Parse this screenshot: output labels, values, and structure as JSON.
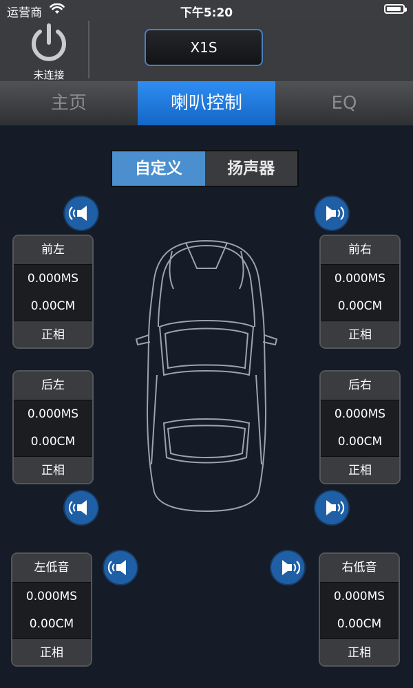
{
  "status_bar": {
    "carrier": "运营商",
    "time": "下午5:20",
    "battery_level": 0.9
  },
  "header": {
    "power_label": "未连接",
    "device_name": "X1S"
  },
  "tabs": [
    {
      "label": "主页",
      "active": false
    },
    {
      "label": "喇叭控制",
      "active": true
    },
    {
      "label": "EQ",
      "active": false
    }
  ],
  "segment": [
    {
      "label": "自定义",
      "active": true
    },
    {
      "label": "扬声器",
      "active": false
    }
  ],
  "channels": {
    "front_left": {
      "name": "前左",
      "delay": "0.000MS",
      "distance": "0.00CM",
      "phase": "正相"
    },
    "front_right": {
      "name": "前右",
      "delay": "0.000MS",
      "distance": "0.00CM",
      "phase": "正相"
    },
    "rear_left": {
      "name": "后左",
      "delay": "0.000MS",
      "distance": "0.00CM",
      "phase": "正相"
    },
    "rear_right": {
      "name": "后右",
      "delay": "0.000MS",
      "distance": "0.00CM",
      "phase": "正相"
    },
    "sub_left": {
      "name": "左低音",
      "delay": "0.000MS",
      "distance": "0.00CM",
      "phase": "正相"
    },
    "sub_right": {
      "name": "右低音",
      "delay": "0.000MS",
      "distance": "0.00CM",
      "phase": "正相"
    }
  },
  "colors": {
    "accent": "#1f7fe6",
    "segment_active": "#4b8fce",
    "background": "#151c27"
  },
  "icons": [
    "wifi-icon",
    "battery-icon",
    "power-icon",
    "speaker-icon",
    "car-icon"
  ]
}
